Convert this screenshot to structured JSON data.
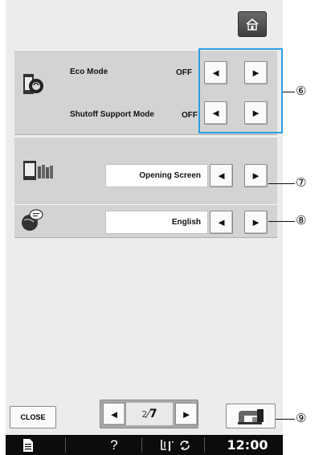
{
  "panels": {
    "eco": {
      "eco_label": "Eco Mode",
      "eco_value": "OFF",
      "shutoff_label": "Shutoff Support Mode",
      "shutoff_value": "OFF"
    },
    "screen": {
      "value": "Opening Screen"
    },
    "language": {
      "value": "English"
    }
  },
  "arrows": {
    "left": "◄",
    "right": "►"
  },
  "callouts": {
    "c6": "⑥",
    "c7": "⑦",
    "c8": "⑧",
    "c9": "⑨"
  },
  "footer": {
    "close_label": "CLOSE",
    "page_current": "2",
    "page_total": "7"
  },
  "taskbar": {
    "help": "?",
    "time": "12:00"
  },
  "icons": {
    "home": "home-icon",
    "eco": "eco-mode-icon",
    "screen": "opening-screen-icon",
    "language": "globe-speech-icon",
    "machine": "sewing-machine-icon",
    "doc": "document-icon",
    "presser": "presser-foot-icon",
    "rotate": "rotate-arrows-icon"
  },
  "colors": {
    "highlight": "#2e9ee6",
    "taskbar": "#0c0c0c",
    "panel": "#d3d3d3"
  }
}
